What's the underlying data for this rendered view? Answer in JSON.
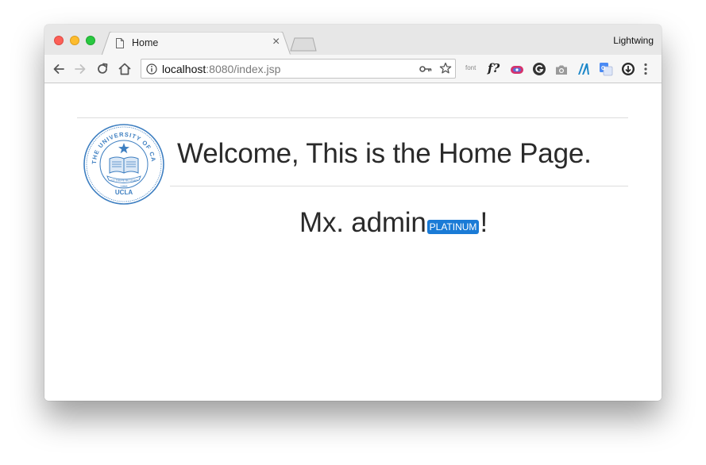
{
  "browser": {
    "tab": {
      "title": "Home",
      "close_glyph": "×"
    },
    "profile_name": "Lightwing",
    "address_bar": {
      "host": "localhost",
      "rest": ":8080/index.jsp"
    },
    "extensions": {
      "font_label": "font",
      "f_label": "f?"
    },
    "icons": [
      "back-icon",
      "forward-icon",
      "reload-icon",
      "home-icon",
      "info-icon",
      "key-icon",
      "star-icon",
      "menu-icon"
    ]
  },
  "page": {
    "title": "Welcome, This is the Home Page.",
    "greeting_prefix": "Mx. admin",
    "tier_badge": "PLATINUM",
    "greeting_suffix": "!",
    "seal_text": {
      "ring": "THE UNIVERSITY OF CALIFORNIA",
      "bottom": "UCLA",
      "motto": "LET THERE BE LIGHT",
      "year": "1868"
    }
  },
  "colors": {
    "badge": "#1a7bd6",
    "seal": "#3e7fc1",
    "heading": "#2a2a2a"
  }
}
